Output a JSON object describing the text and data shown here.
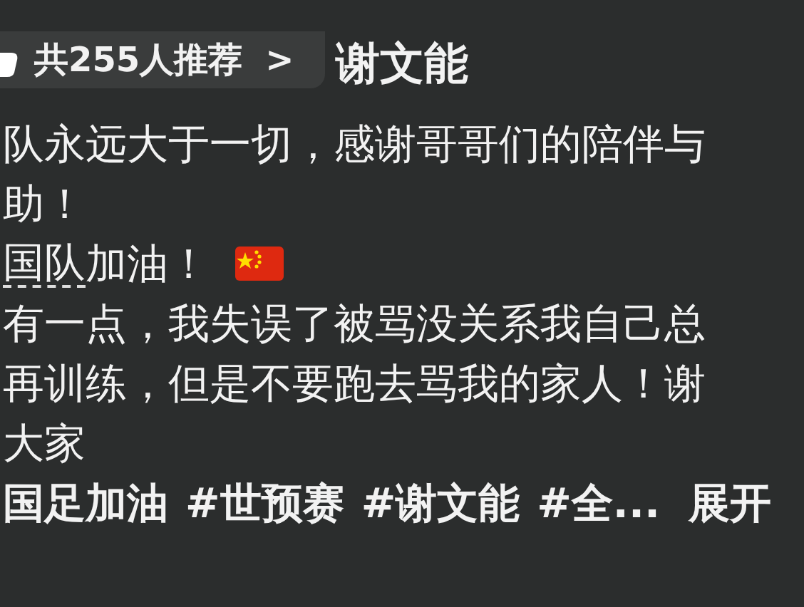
{
  "recommend_pill": {
    "text": "共255人推荐",
    "chevron": ">"
  },
  "author": "谢文能",
  "caption": [
    {
      "kind": "text",
      "text": "队永远大于一切，感谢哥哥们的陪伴与"
    },
    {
      "kind": "text",
      "text": "助！"
    },
    {
      "kind": "mention",
      "mention": "国队",
      "text": "加油！"
    },
    {
      "kind": "text",
      "text": "有一点，我失误了被骂没关系我自己总"
    },
    {
      "kind": "text",
      "text": "再训练，但是不要跑去骂我的家人！谢"
    },
    {
      "kind": "text",
      "text": "大家"
    }
  ],
  "hashtags": [
    "国足加油",
    "#世预赛",
    "#谢文能",
    "#全..."
  ],
  "expand": "展开"
}
